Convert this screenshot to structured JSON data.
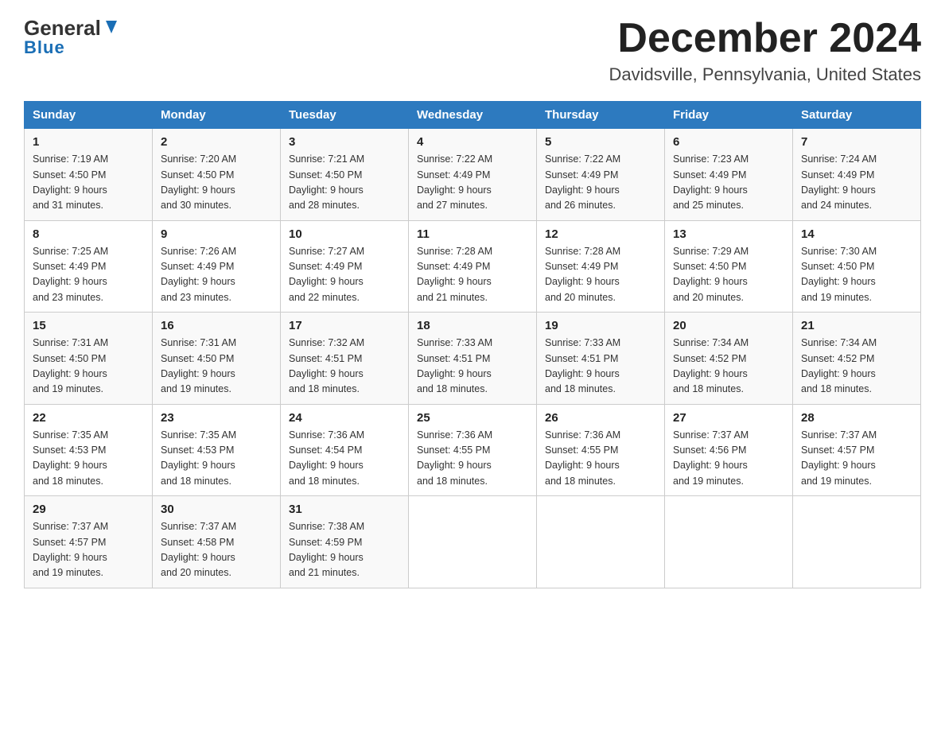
{
  "logo": {
    "general": "General",
    "blue": "Blue"
  },
  "header": {
    "month": "December 2024",
    "location": "Davidsville, Pennsylvania, United States"
  },
  "weekdays": [
    "Sunday",
    "Monday",
    "Tuesday",
    "Wednesday",
    "Thursday",
    "Friday",
    "Saturday"
  ],
  "weeks": [
    [
      {
        "day": "1",
        "sunrise": "7:19 AM",
        "sunset": "4:50 PM",
        "daylight": "9 hours and 31 minutes."
      },
      {
        "day": "2",
        "sunrise": "7:20 AM",
        "sunset": "4:50 PM",
        "daylight": "9 hours and 30 minutes."
      },
      {
        "day": "3",
        "sunrise": "7:21 AM",
        "sunset": "4:50 PM",
        "daylight": "9 hours and 28 minutes."
      },
      {
        "day": "4",
        "sunrise": "7:22 AM",
        "sunset": "4:49 PM",
        "daylight": "9 hours and 27 minutes."
      },
      {
        "day": "5",
        "sunrise": "7:22 AM",
        "sunset": "4:49 PM",
        "daylight": "9 hours and 26 minutes."
      },
      {
        "day": "6",
        "sunrise": "7:23 AM",
        "sunset": "4:49 PM",
        "daylight": "9 hours and 25 minutes."
      },
      {
        "day": "7",
        "sunrise": "7:24 AM",
        "sunset": "4:49 PM",
        "daylight": "9 hours and 24 minutes."
      }
    ],
    [
      {
        "day": "8",
        "sunrise": "7:25 AM",
        "sunset": "4:49 PM",
        "daylight": "9 hours and 23 minutes."
      },
      {
        "day": "9",
        "sunrise": "7:26 AM",
        "sunset": "4:49 PM",
        "daylight": "9 hours and 23 minutes."
      },
      {
        "day": "10",
        "sunrise": "7:27 AM",
        "sunset": "4:49 PM",
        "daylight": "9 hours and 22 minutes."
      },
      {
        "day": "11",
        "sunrise": "7:28 AM",
        "sunset": "4:49 PM",
        "daylight": "9 hours and 21 minutes."
      },
      {
        "day": "12",
        "sunrise": "7:28 AM",
        "sunset": "4:49 PM",
        "daylight": "9 hours and 20 minutes."
      },
      {
        "day": "13",
        "sunrise": "7:29 AM",
        "sunset": "4:50 PM",
        "daylight": "9 hours and 20 minutes."
      },
      {
        "day": "14",
        "sunrise": "7:30 AM",
        "sunset": "4:50 PM",
        "daylight": "9 hours and 19 minutes."
      }
    ],
    [
      {
        "day": "15",
        "sunrise": "7:31 AM",
        "sunset": "4:50 PM",
        "daylight": "9 hours and 19 minutes."
      },
      {
        "day": "16",
        "sunrise": "7:31 AM",
        "sunset": "4:50 PM",
        "daylight": "9 hours and 19 minutes."
      },
      {
        "day": "17",
        "sunrise": "7:32 AM",
        "sunset": "4:51 PM",
        "daylight": "9 hours and 18 minutes."
      },
      {
        "day": "18",
        "sunrise": "7:33 AM",
        "sunset": "4:51 PM",
        "daylight": "9 hours and 18 minutes."
      },
      {
        "day": "19",
        "sunrise": "7:33 AM",
        "sunset": "4:51 PM",
        "daylight": "9 hours and 18 minutes."
      },
      {
        "day": "20",
        "sunrise": "7:34 AM",
        "sunset": "4:52 PM",
        "daylight": "9 hours and 18 minutes."
      },
      {
        "day": "21",
        "sunrise": "7:34 AM",
        "sunset": "4:52 PM",
        "daylight": "9 hours and 18 minutes."
      }
    ],
    [
      {
        "day": "22",
        "sunrise": "7:35 AM",
        "sunset": "4:53 PM",
        "daylight": "9 hours and 18 minutes."
      },
      {
        "day": "23",
        "sunrise": "7:35 AM",
        "sunset": "4:53 PM",
        "daylight": "9 hours and 18 minutes."
      },
      {
        "day": "24",
        "sunrise": "7:36 AM",
        "sunset": "4:54 PM",
        "daylight": "9 hours and 18 minutes."
      },
      {
        "day": "25",
        "sunrise": "7:36 AM",
        "sunset": "4:55 PM",
        "daylight": "9 hours and 18 minutes."
      },
      {
        "day": "26",
        "sunrise": "7:36 AM",
        "sunset": "4:55 PM",
        "daylight": "9 hours and 18 minutes."
      },
      {
        "day": "27",
        "sunrise": "7:37 AM",
        "sunset": "4:56 PM",
        "daylight": "9 hours and 19 minutes."
      },
      {
        "day": "28",
        "sunrise": "7:37 AM",
        "sunset": "4:57 PM",
        "daylight": "9 hours and 19 minutes."
      }
    ],
    [
      {
        "day": "29",
        "sunrise": "7:37 AM",
        "sunset": "4:57 PM",
        "daylight": "9 hours and 19 minutes."
      },
      {
        "day": "30",
        "sunrise": "7:37 AM",
        "sunset": "4:58 PM",
        "daylight": "9 hours and 20 minutes."
      },
      {
        "day": "31",
        "sunrise": "7:38 AM",
        "sunset": "4:59 PM",
        "daylight": "9 hours and 21 minutes."
      },
      null,
      null,
      null,
      null
    ]
  ],
  "labels": {
    "sunrise": "Sunrise:",
    "sunset": "Sunset:",
    "daylight": "Daylight:"
  }
}
